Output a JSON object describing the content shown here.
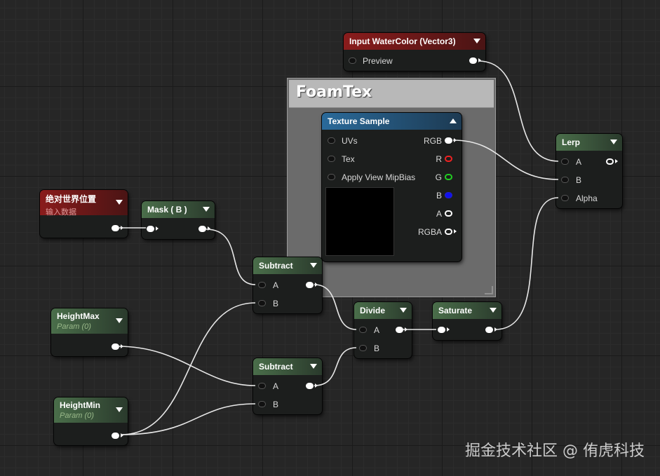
{
  "comment": {
    "title": "FoamTex"
  },
  "nodes": {
    "input_watercolor": {
      "title": "Input WaterColor (Vector3)",
      "output": "Preview"
    },
    "texture_sample": {
      "title": "Texture Sample",
      "inputs": [
        "UVs",
        "Tex",
        "Apply View MipBias"
      ],
      "outputs": [
        "RGB",
        "R",
        "G",
        "B",
        "A",
        "RGBA"
      ]
    },
    "lerp": {
      "title": "Lerp",
      "inputs": [
        "A",
        "B",
        "Alpha"
      ]
    },
    "absolute_world_position": {
      "title": "绝对世界位置",
      "subtitle": "输入数据"
    },
    "mask": {
      "title": "Mask ( B )"
    },
    "subtract_top": {
      "title": "Subtract",
      "inputs": [
        "A",
        "B"
      ]
    },
    "subtract_bottom": {
      "title": "Subtract",
      "inputs": [
        "A",
        "B"
      ]
    },
    "divide": {
      "title": "Divide",
      "inputs": [
        "A",
        "B"
      ]
    },
    "saturate": {
      "title": "Saturate"
    },
    "height_max": {
      "title": "HeightMax",
      "subtitle": "Param (0)"
    },
    "height_min": {
      "title": "HeightMin",
      "subtitle": "Param (0)"
    }
  },
  "watermark": "掘金技术社区 @ 侑虎科技",
  "colors": {
    "background": "#262626",
    "wire": "#ffffff",
    "pin_r": "#ee2222",
    "pin_g": "#22cc22",
    "pin_b": "#1111ee"
  }
}
